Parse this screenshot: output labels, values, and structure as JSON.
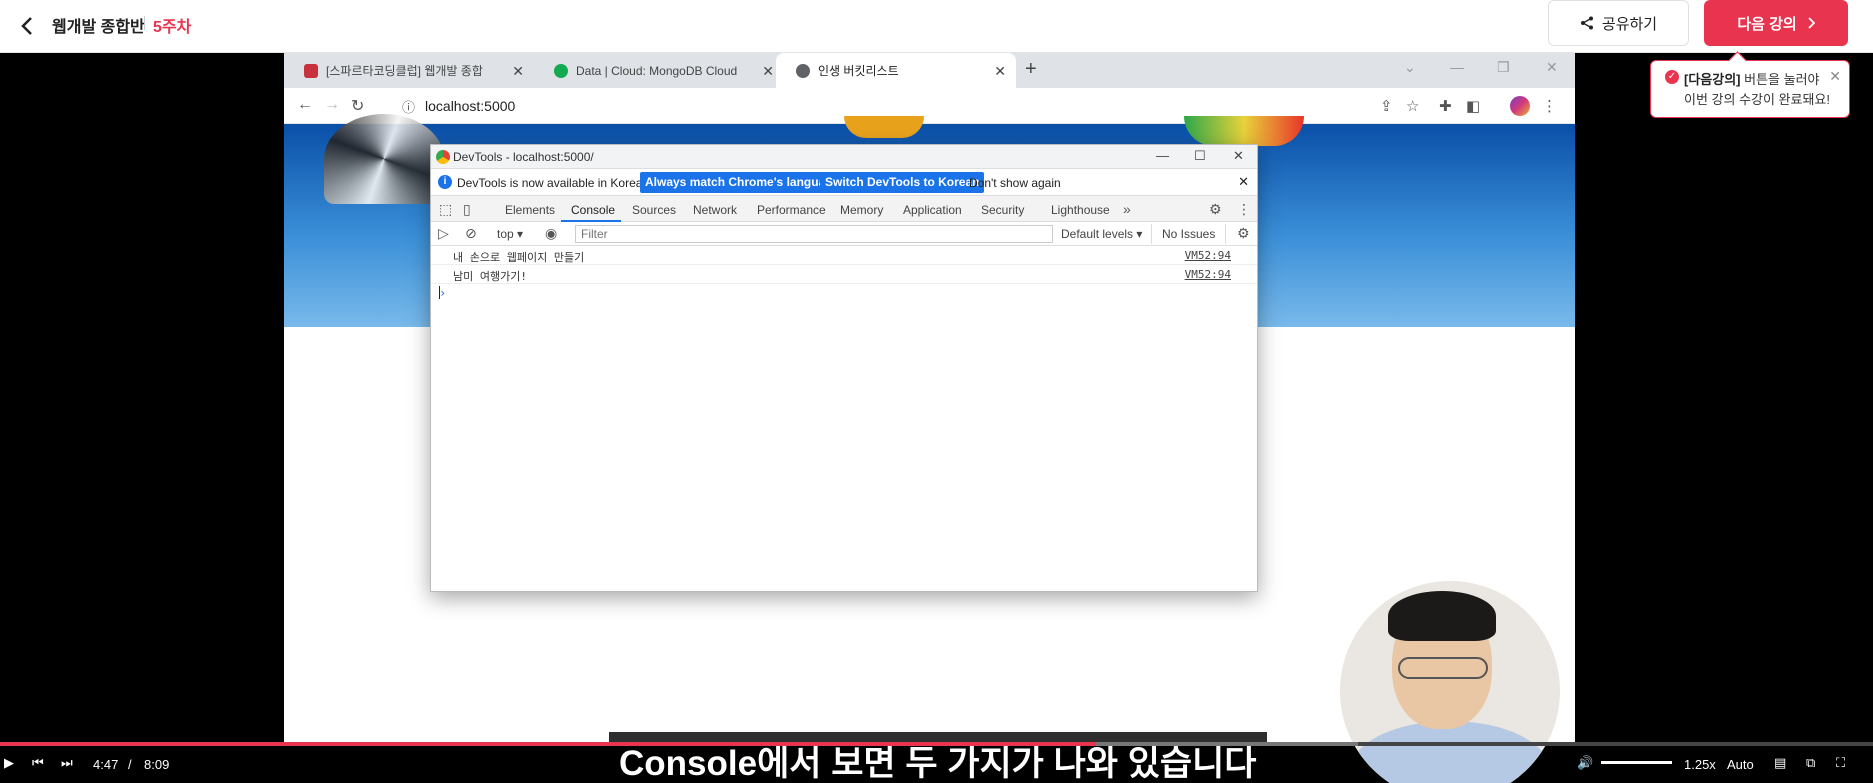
{
  "header": {
    "course_title": "웹개발 종합반",
    "week": "5주차",
    "share_label": "공유하기",
    "next_label": "다음 강의"
  },
  "toast": {
    "line1_bold": "[다음강의]",
    "line1_rest": " 버튼을 눌러야",
    "line2": "이번 강의 수강이 완료돼요!"
  },
  "browser": {
    "tabs": [
      {
        "title": "[스파르타코딩클럽] 웹개발 종합",
        "icon_color": "#c8323c"
      },
      {
        "title": "Data | Cloud: MongoDB Cloud",
        "icon_color": "#13aa52"
      },
      {
        "title": "인생 버킷리스트",
        "icon_color": "#5f6368"
      }
    ],
    "url": "localhost:5000"
  },
  "devtools": {
    "window_title": "DevTools - localhost:5000/",
    "info_text": "DevTools is now available in Korean!",
    "btn_match": "Always match Chrome's language",
    "btn_switch": "Switch DevTools to Korean",
    "btn_dont": "Don't show again",
    "tabs": [
      "Elements",
      "Console",
      "Sources",
      "Network",
      "Performance",
      "Memory",
      "Application",
      "Security",
      "Lighthouse"
    ],
    "context": "top",
    "filter_placeholder": "Filter",
    "levels": "Default levels",
    "issues": "No Issues",
    "logs": [
      {
        "message": "내 손으로 웹페이지 만들기",
        "source": "VM52:94"
      },
      {
        "message": "남미 여행가기!",
        "source": "VM52:94"
      }
    ]
  },
  "subtitle": "Console에서 보면 두 가지가 나와 있습니다",
  "player": {
    "current_time": "4:47",
    "separator": "/",
    "duration": "8:09",
    "played_fraction": 0.585,
    "buffered_fraction": 0.725,
    "speed": "1.25x",
    "quality": "Auto"
  },
  "colors": {
    "brand": "#e8344e",
    "devtools_blue": "#1a73e8"
  }
}
